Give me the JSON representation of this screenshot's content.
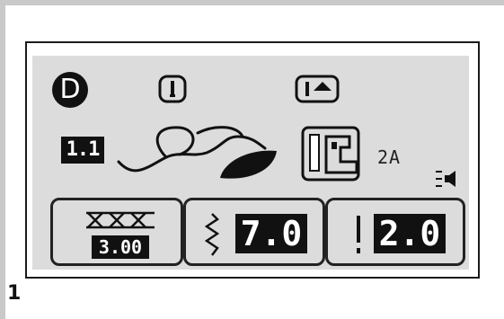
{
  "figure_label": "1",
  "lcd": {
    "mode_badge": "D",
    "pattern_number": "1.1",
    "presser_foot_code": "2A",
    "icons": {
      "mode": "mode-d-badge",
      "needle_position": "needle-icon",
      "needle_up": "needle-up-icon",
      "stitch_pattern": "leaf-stitch-pattern-icon",
      "presser_foot": "presser-foot-icon",
      "sound": "speaker-icon",
      "stitch_preview": "cross-stitch-icon",
      "stitch_width": "zigzag-width-icon",
      "stitch_length": "straight-length-icon"
    },
    "settings": {
      "pattern_length": "3.00",
      "stitch_width": "7.0",
      "stitch_length": "2.0"
    }
  }
}
